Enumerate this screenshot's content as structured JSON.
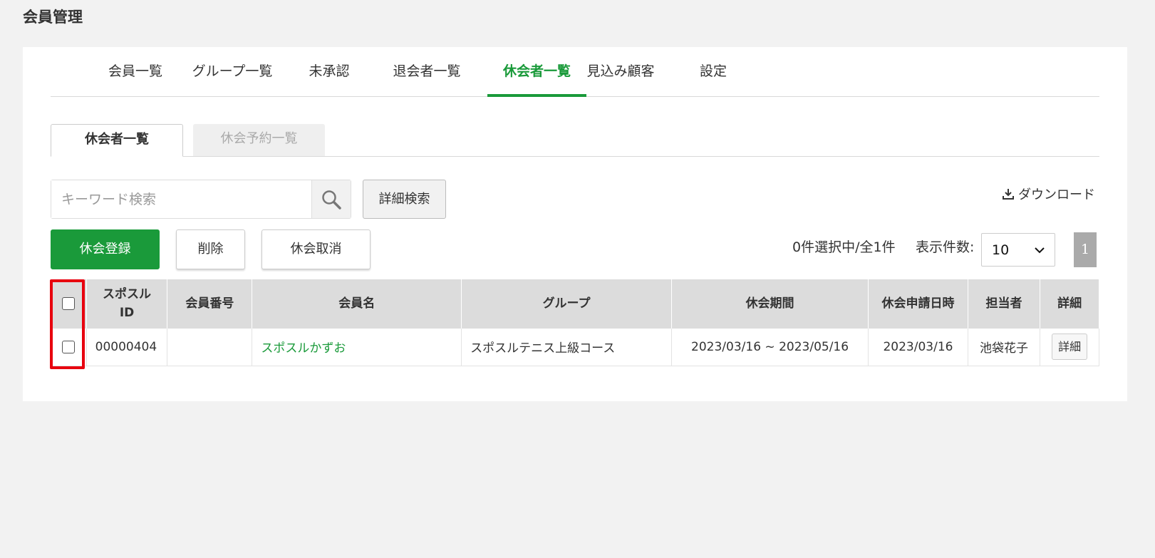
{
  "page": {
    "title": "会員管理"
  },
  "main_tabs": [
    {
      "label": "会員一覧",
      "active": false
    },
    {
      "label": "グループ一覧",
      "active": false
    },
    {
      "label": "未承認",
      "active": false
    },
    {
      "label": "退会者一覧",
      "active": false
    },
    {
      "label": "休会者一覧",
      "active": true
    },
    {
      "label": "見込み顧客",
      "active": false
    },
    {
      "label": "設定",
      "active": false
    }
  ],
  "sub_tabs": [
    {
      "label": "休会者一覧",
      "active": true
    },
    {
      "label": "休会予約一覧",
      "active": false
    }
  ],
  "search": {
    "placeholder": "キーワード検索",
    "value": "",
    "advanced_label": "詳細検索"
  },
  "download_label": "ダウンロード",
  "actions": {
    "register": "休会登録",
    "delete": "削除",
    "cancel": "休会取消"
  },
  "pagination": {
    "selection_text": "0件選択中/全1件",
    "per_page_label": "表示件数:",
    "per_page_value": "10",
    "current_page": "1"
  },
  "table": {
    "headers": [
      "",
      "スポスル ID",
      "会員番号",
      "会員名",
      "グループ",
      "休会期間",
      "休会申請日時",
      "担当者",
      "詳細"
    ],
    "rows": [
      {
        "spo_id": "00000404",
        "member_no": "",
        "member_name": "スポスルかずお",
        "group": "スポスルテニス上級コース",
        "period": "2023/03/16 ~ 2023/05/16",
        "applied": "2023/03/16",
        "staff": "池袋花子",
        "detail_label": "詳細"
      }
    ]
  },
  "colors": {
    "accent": "#1a9a3a",
    "highlight": "#e8000e"
  }
}
